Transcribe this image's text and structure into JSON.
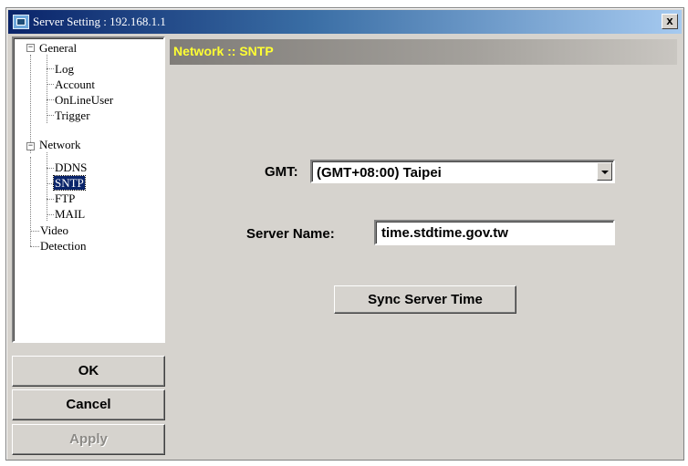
{
  "window": {
    "title": "Server Setting : 192.168.1.1",
    "close_label": "x"
  },
  "tree": {
    "nodes": [
      {
        "label": "General",
        "expanded": true
      },
      {
        "label": "Log"
      },
      {
        "label": "Account"
      },
      {
        "label": "OnLineUser"
      },
      {
        "label": "Trigger"
      },
      {
        "label": "Network",
        "expanded": true
      },
      {
        "label": "DDNS"
      },
      {
        "label": "SNTP",
        "selected": true
      },
      {
        "label": "FTP"
      },
      {
        "label": "MAIL"
      },
      {
        "label": "Video"
      },
      {
        "label": "Detection"
      }
    ],
    "expander_symbol": "−"
  },
  "buttons": {
    "ok": "OK",
    "cancel": "Cancel",
    "apply": "Apply"
  },
  "panel": {
    "header": "Network :: SNTP",
    "gmt_label": "GMT:",
    "gmt_value": "(GMT+08:00) Taipei",
    "server_name_label": "Server Name:",
    "server_name_value": "time.stdtime.gov.tw",
    "sync_button": "Sync Server Time"
  },
  "colors": {
    "titlebar_start": "#0a246a",
    "header_text": "#ffff33",
    "selection": "#0a246a",
    "dialog_face": "#d6d3ce"
  }
}
